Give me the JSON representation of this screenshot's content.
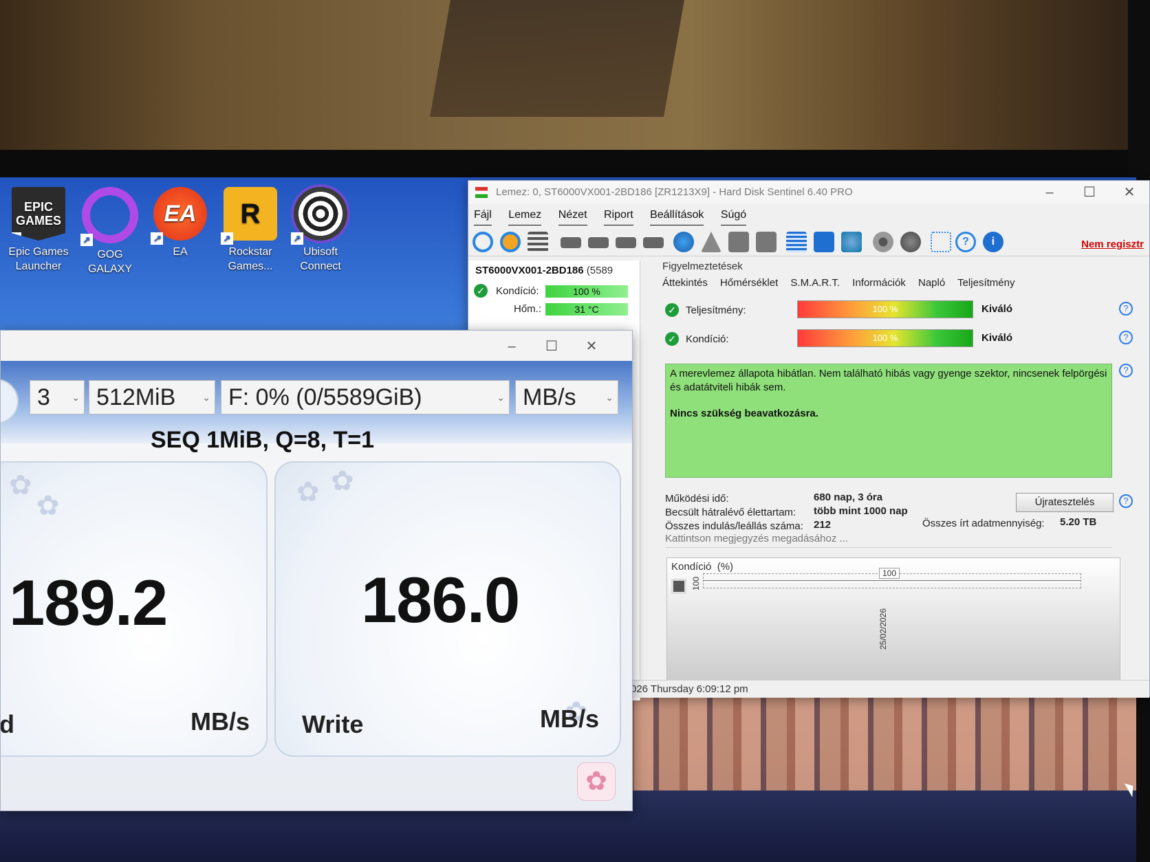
{
  "desktop": {
    "icons": [
      {
        "label": "Epic Games Launcher",
        "logo": "EPIC GAMES"
      },
      {
        "label": "GOG GALAXY"
      },
      {
        "label": "EA",
        "logo": "EA"
      },
      {
        "label": "Rockstar Games...",
        "logo": "R"
      },
      {
        "label": "Ubisoft Connect"
      }
    ],
    "shortcut_icon": "shortcut-arrow-icon"
  },
  "hds": {
    "title": "Lemez: 0, ST6000VX001-2BD186 [ZR1213X9]  -  Hard Disk Sentinel 6.40 PRO",
    "menu": [
      "Fájl",
      "Lemez",
      "Nézet",
      "Riport",
      "Beállítások",
      "Súgó"
    ],
    "unregistered": "Nem regisztr",
    "disk": {
      "name": "ST6000VX001-2BD186",
      "size": "(5589",
      "condition_label": "Kondíció:",
      "condition_value": "100 %",
      "temp_label": "Hőm.:",
      "temp_value": "31 °C"
    },
    "warnings_tab": "Figyelmeztetések",
    "tabs": [
      "Áttekintés",
      "Hőmérséklet",
      "S.M.A.R.T.",
      "Információk",
      "Napló",
      "Teljesítmény"
    ],
    "performance_label": "Teljesítmény:",
    "performance_value": "100 %",
    "performance_level": 1.0,
    "performance_rating": "Kiváló",
    "health_label": "Kondíció:",
    "health_value": "100 %",
    "health_level": 1.0,
    "health_rating": "Kiváló",
    "status_text": "A merevlemez állapota hibátlan. Nem található hibás vagy gyenge szektor, nincsenek felpörgési és adatátviteli hibák sem.",
    "status_action": "Nincs szükség beavatkozásra.",
    "uptime_label": "Működési idő:",
    "uptime_value": "680 nap, 3 óra",
    "remaining_label": "Becsült hátralévő élettartam:",
    "remaining_value": "több mint 1000 nap",
    "starts_label": "Összes indulás/leállás száma:",
    "starts_value": "212",
    "written_label": "Összes írt adatmennyiség:",
    "written_value": "5.20 TB",
    "retest_button": "Újratesztelés",
    "note_placeholder": "Kattintson megjegyzés megadásához ...",
    "graph_title": "Kondíció",
    "graph_unit": "(%)",
    "graph_y_label": "100",
    "graph_point_value": "100",
    "graph_date": "25/02/2026",
    "statusbar": "026 Thursday 6:09:12 pm",
    "colors": {
      "ok_green": "#1e9c3a",
      "status_bg": "#8fe07a",
      "link_red": "#d10000"
    }
  },
  "cdm": {
    "count": "3",
    "size": "512MiB",
    "drive": "F: 0% (0/5589GiB)",
    "unit_select": "MB/s",
    "test_title": "SEQ 1MiB, Q=8, T=1",
    "read_value": "189.2",
    "read_label": "d",
    "read_unit": "MB/s",
    "write_value": "186.0",
    "write_label": "Write",
    "write_unit": "MB/s"
  }
}
